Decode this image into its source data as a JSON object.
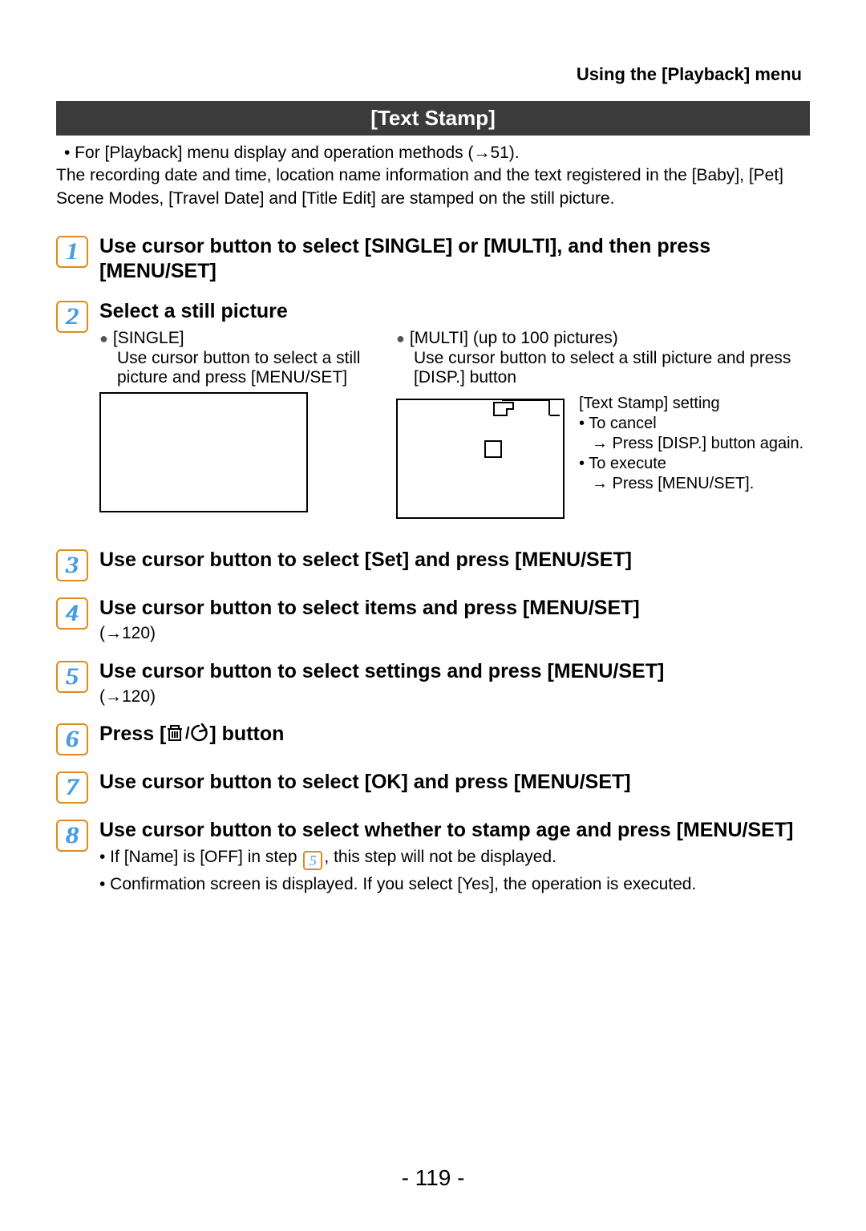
{
  "header": {
    "breadcrumb": "Using the [Playback] menu"
  },
  "section": {
    "title": "[Text Stamp]"
  },
  "intro": {
    "line1": " • For [Playback] menu display and operation methods (→51).",
    "line2": "The recording date and time, location name information and the text registered in the [Baby], [Pet] Scene Modes, [Travel Date] and [Title Edit] are stamped on the still picture."
  },
  "steps": [
    {
      "num": "1",
      "title": "Use cursor button to select [SINGLE] or [MULTI], and then press [MENU/SET]"
    },
    {
      "num": "2",
      "title": "Select a still picture",
      "single": {
        "label": "[SINGLE]",
        "detail": "Use cursor button to select a still picture and press [MENU/SET]"
      },
      "multi": {
        "label": "[MULTI] (up to 100 pictures)",
        "detail": "Use cursor button to select a still picture and press [DISP.] button"
      },
      "callout": {
        "setting_label": "[Text Stamp] setting",
        "cancel_label": "To cancel",
        "cancel_action": "→ Press [DISP.] button again.",
        "execute_label": "To execute",
        "execute_action": "→ Press [MENU/SET]."
      }
    },
    {
      "num": "3",
      "title": "Use cursor button to select [Set] and press [MENU/SET]"
    },
    {
      "num": "4",
      "title": "Use cursor button to select items and press [MENU/SET]",
      "sub": "(→120)"
    },
    {
      "num": "5",
      "title": "Use cursor button to select settings and press [MENU/SET]",
      "sub": "(→120)"
    },
    {
      "num": "6",
      "title_prefix": "Press [",
      "title_suffix": "] button"
    },
    {
      "num": "7",
      "title": "Use cursor button to select [OK] and press [MENU/SET]"
    },
    {
      "num": "8",
      "title": "Use cursor button to select whether to stamp age and press [MENU/SET]",
      "notes": [
        {
          "prefix": " • If [Name] is [OFF] in step ",
          "inline_num": "5",
          "suffix": ", this step will not be displayed."
        },
        {
          "prefix": " • Confirmation screen is displayed. If you select [Yes], the operation is executed."
        }
      ]
    }
  ],
  "page_number": "- 119 -"
}
